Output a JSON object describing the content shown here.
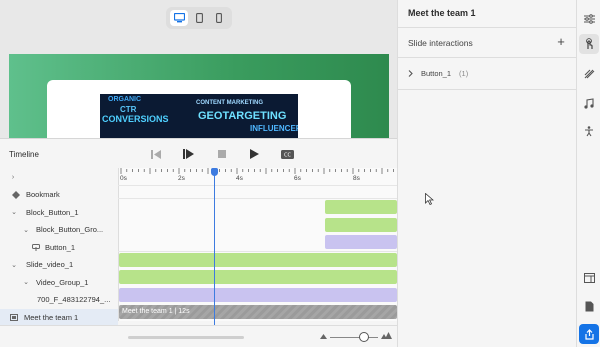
{
  "panel": {
    "title": "Meet the team 1",
    "slide_interactions": "Slide interactions",
    "add_label": "+",
    "interaction_item": "Button_1",
    "interaction_count": "(1)"
  },
  "timeline": {
    "title": "Timeline",
    "ruler_labels": [
      "0s",
      "2s",
      "4s",
      "6s",
      "8s"
    ],
    "rows": [
      {
        "label": "Bookmark",
        "chevron": "",
        "icon": "bookmark-icon"
      },
      {
        "label": "Block_Button_1",
        "chevron": "⌄"
      },
      {
        "label": "Block_Button_Gro...",
        "chevron": "⌄"
      },
      {
        "label": "Button_1",
        "chevron": "",
        "icon": "button-icon"
      },
      {
        "label": "Slide_video_1",
        "chevron": "⌄"
      },
      {
        "label": "Video_Group_1",
        "chevron": "⌄"
      },
      {
        "label": "700_F_483122794_...",
        "chevron": ""
      },
      {
        "label": "Meet the team 1",
        "chevron": "",
        "icon": "slide-icon"
      }
    ],
    "slide_bar_label": "Meet the team 1 | 12s"
  },
  "video_thumb": {
    "words": [
      "ORGANIC",
      "CTR",
      "CONVERSIONS",
      "CONTENT MARKETING",
      "GEOTARGETING",
      "INFLUENCER"
    ]
  },
  "colors": {
    "accent": "#1473e6",
    "playhead": "#3d7be0",
    "track_green": "#b7e38a",
    "track_purple": "#c9c3f0",
    "slide_green": "#4fae74"
  },
  "icons": {
    "device_desktop": "desktop-icon",
    "device_tablet": "tablet-icon",
    "device_phone": "phone-icon",
    "rail": [
      "properties-icon",
      "interactions-icon",
      "effects-icon",
      "audio-icon",
      "accessibility-icon",
      "layout-icon",
      "document-icon",
      "share-icon"
    ]
  }
}
